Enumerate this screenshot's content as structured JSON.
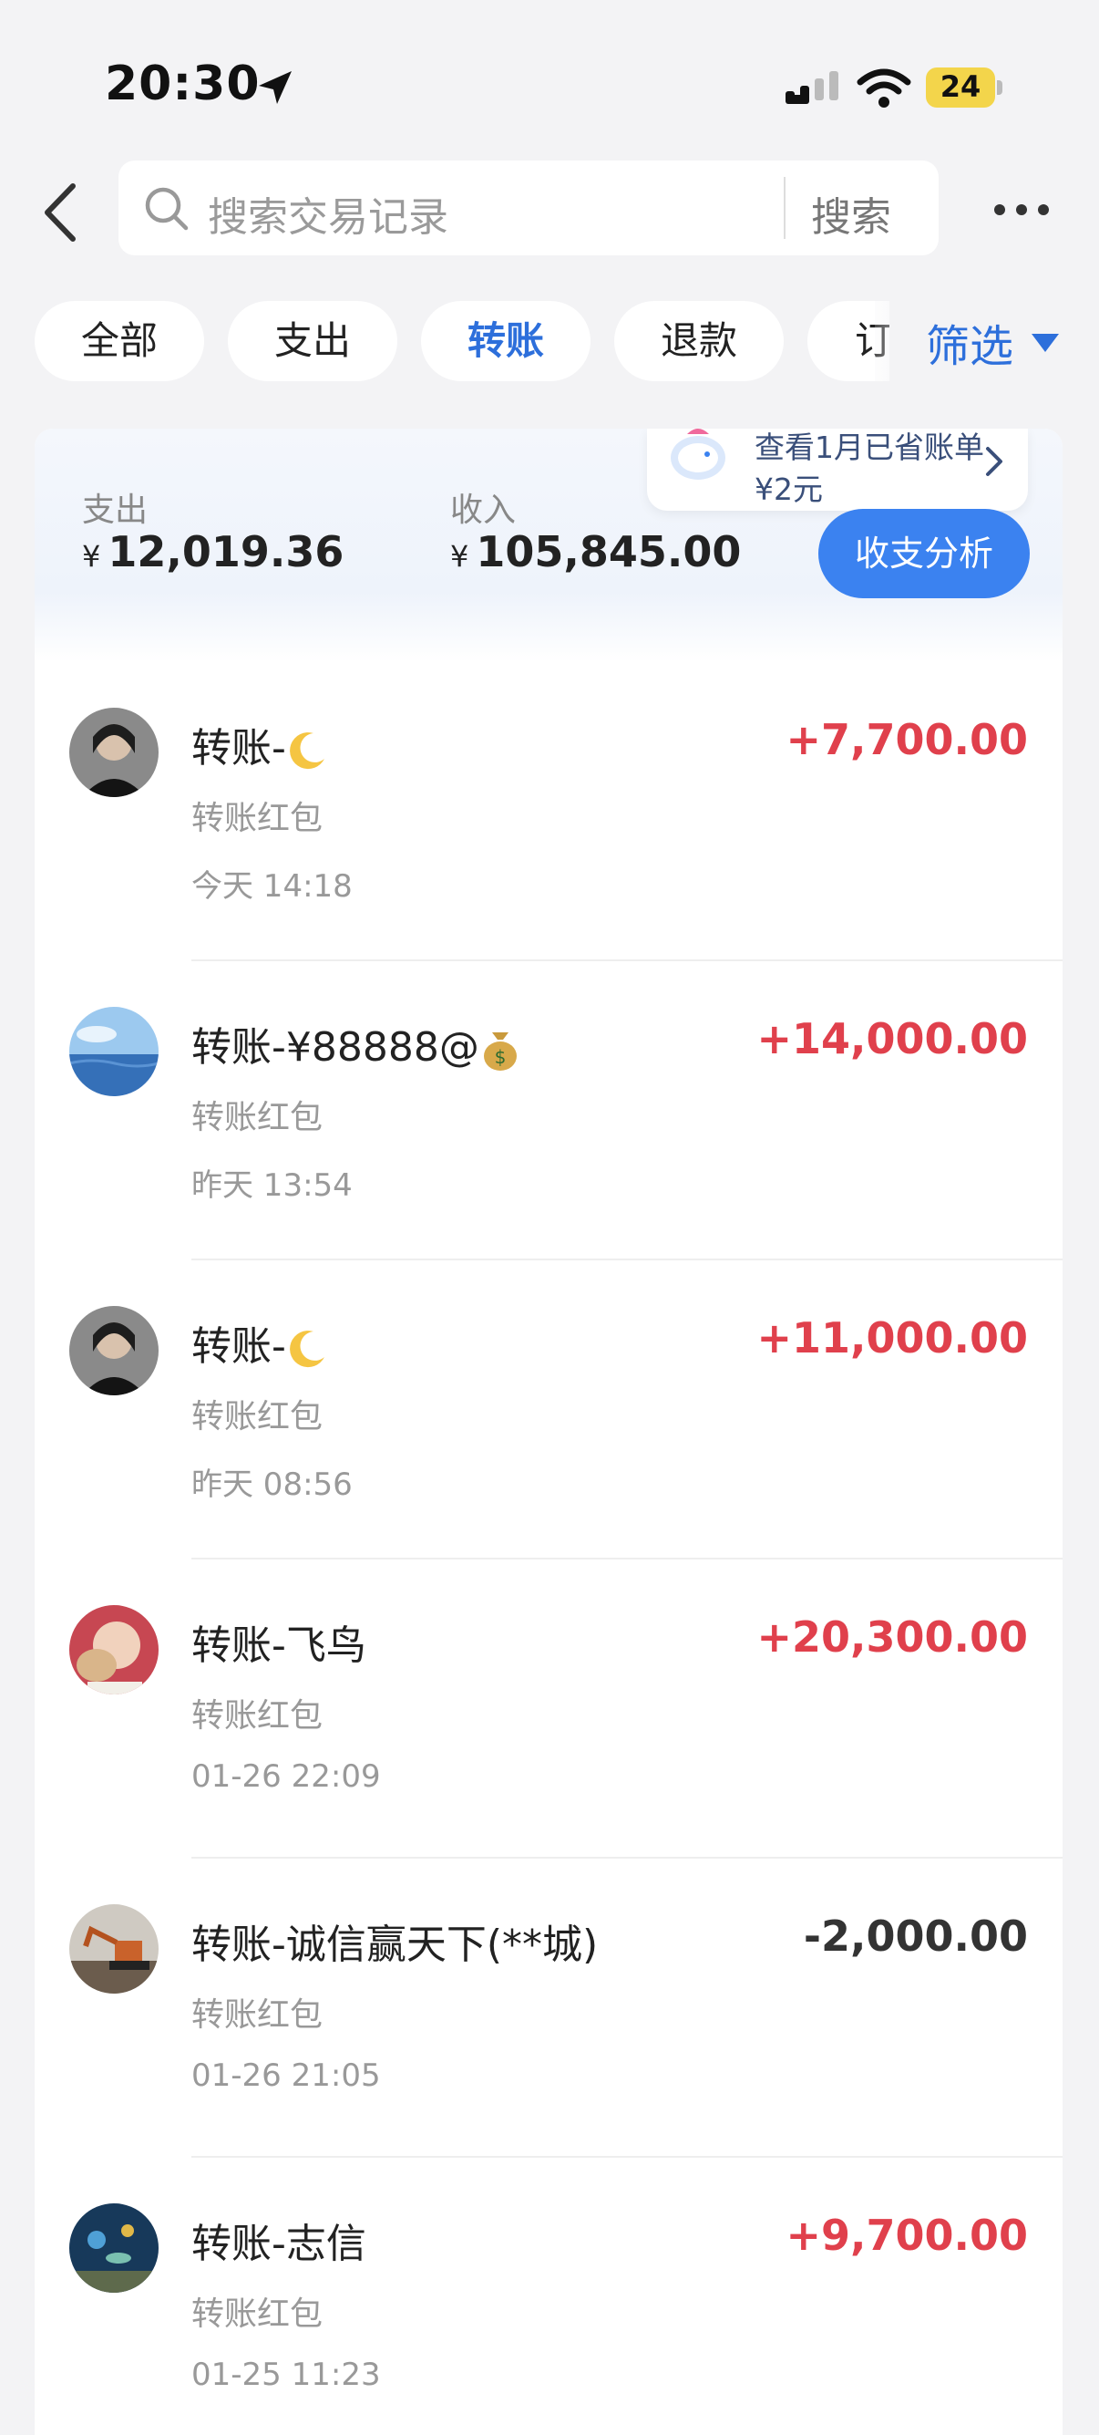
{
  "status_bar": {
    "time": "20:30",
    "battery": "24"
  },
  "search": {
    "placeholder": "搜索交易记录",
    "button_label": "搜索"
  },
  "filters": {
    "chips": [
      "全部",
      "支出",
      "转账",
      "退款"
    ],
    "partial_chip": "订单",
    "active": "转账",
    "filter_label": "筛选"
  },
  "summary": {
    "expense_label": "支出",
    "expense_currency": "¥",
    "expense_value": "12,019.36",
    "income_label": "收入",
    "income_currency": "¥",
    "income_value": "105,845.00",
    "tooltip_text": "查看1月已省账单¥2元",
    "analysis_button": "收支分析"
  },
  "transactions": [
    {
      "title": "转账-",
      "emoji": "moon-icon",
      "subtitle": "转账红包",
      "time": "今天 14:18",
      "amount": "+7,700.00",
      "avatar": "avatar-person-dark"
    },
    {
      "title": "转账-¥88888@",
      "emoji": "money-bag-icon",
      "subtitle": "转账红包",
      "time": "昨天 13:54",
      "amount": "+14,000.00",
      "avatar": "avatar-sea"
    },
    {
      "title": "转账-",
      "emoji": "moon-icon",
      "subtitle": "转账红包",
      "time": "昨天 08:56",
      "amount": "+11,000.00",
      "avatar": "avatar-person-dark"
    },
    {
      "title": "转账-飞鸟",
      "emoji": "",
      "subtitle": "转账红包",
      "time": "01-26 22:09",
      "amount": "+20,300.00",
      "avatar": "avatar-child"
    },
    {
      "title": "转账-诚信赢天下(**城)",
      "emoji": "",
      "subtitle": "转账红包",
      "time": "01-26 21:05",
      "amount": "-2,000.00",
      "avatar": "avatar-excavator"
    },
    {
      "title": "转账-志信",
      "emoji": "",
      "subtitle": "转账红包",
      "time": "01-25 11:23",
      "amount": "+9,700.00",
      "avatar": "avatar-aquarium"
    }
  ],
  "colors": {
    "accent": "#2d6fdb",
    "button_blue": "#3b82f0",
    "income_red": "#e0404c",
    "expense_dark": "#333333",
    "background": "#f3f3f5"
  }
}
